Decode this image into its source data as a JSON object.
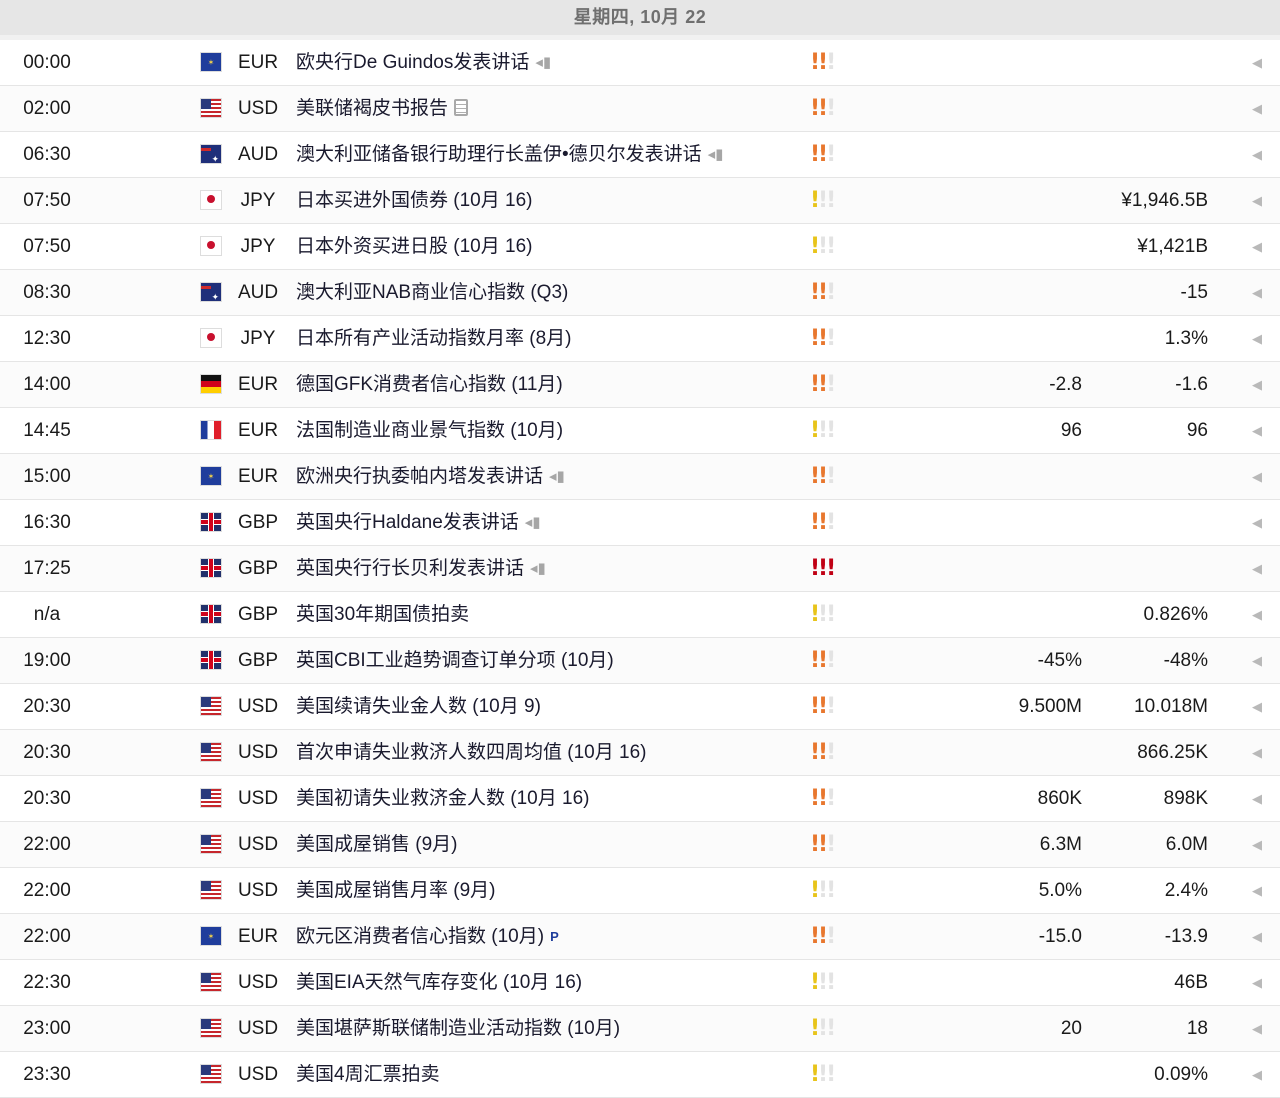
{
  "date_header": "星期四, 10月 22",
  "colors": {
    "impact_high": "#c00014",
    "impact_medium": "#e8772e",
    "impact_low": "#e8c41a",
    "impact_off": "#e3e3e3"
  },
  "events": [
    {
      "time": "00:00",
      "flag": "eu",
      "currency": "EUR",
      "title": "欧央行De Guindos发表讲话",
      "icon": "speaker-icon",
      "impact": 2,
      "forecast": "",
      "previous": ""
    },
    {
      "time": "02:00",
      "flag": "us",
      "currency": "USD",
      "title": "美联储褐皮书报告",
      "icon": "report-icon",
      "impact": 2,
      "forecast": "",
      "previous": ""
    },
    {
      "time": "06:30",
      "flag": "au",
      "currency": "AUD",
      "title": "澳大利亚储备银行助理行长盖伊•德贝尔发表讲话",
      "icon": "speaker-icon",
      "impact": 2,
      "forecast": "",
      "previous": ""
    },
    {
      "time": "07:50",
      "flag": "jp",
      "currency": "JPY",
      "title": "日本买进外国债券 (10月 16)",
      "icon": "",
      "impact": 1,
      "forecast": "",
      "previous": "¥1,946.5B"
    },
    {
      "time": "07:50",
      "flag": "jp",
      "currency": "JPY",
      "title": "日本外资买进日股 (10月 16)",
      "icon": "",
      "impact": 1,
      "forecast": "",
      "previous": "¥1,421B"
    },
    {
      "time": "08:30",
      "flag": "au",
      "currency": "AUD",
      "title": "澳大利亚NAB商业信心指数 (Q3)",
      "icon": "",
      "impact": 2,
      "forecast": "",
      "previous": "-15"
    },
    {
      "time": "12:30",
      "flag": "jp",
      "currency": "JPY",
      "title": "日本所有产业活动指数月率 (8月)",
      "icon": "",
      "impact": 2,
      "forecast": "",
      "previous": "1.3%"
    },
    {
      "time": "14:00",
      "flag": "de",
      "currency": "EUR",
      "title": "德国GFK消费者信心指数 (11月)",
      "icon": "",
      "impact": 2,
      "forecast": "-2.8",
      "previous": "-1.6"
    },
    {
      "time": "14:45",
      "flag": "fr",
      "currency": "EUR",
      "title": "法国制造业商业景气指数 (10月)",
      "icon": "",
      "impact": 1,
      "forecast": "96",
      "previous": "96"
    },
    {
      "time": "15:00",
      "flag": "eu",
      "currency": "EUR",
      "title": "欧洲央行执委帕内塔发表讲话",
      "icon": "speaker-icon",
      "impact": 2,
      "forecast": "",
      "previous": ""
    },
    {
      "time": "16:30",
      "flag": "gb",
      "currency": "GBP",
      "title": "英国央行Haldane发表讲话",
      "icon": "speaker-icon",
      "impact": 2,
      "forecast": "",
      "previous": ""
    },
    {
      "time": "17:25",
      "flag": "gb",
      "currency": "GBP",
      "title": "英国央行行长贝利发表讲话",
      "icon": "speaker-icon",
      "impact": 3,
      "forecast": "",
      "previous": ""
    },
    {
      "time": "n/a",
      "flag": "gb",
      "currency": "GBP",
      "title": "英国30年期国债拍卖",
      "icon": "",
      "impact": 1,
      "forecast": "",
      "previous": "0.826%"
    },
    {
      "time": "19:00",
      "flag": "gb",
      "currency": "GBP",
      "title": "英国CBI工业趋势调查订单分项 (10月)",
      "icon": "",
      "impact": 2,
      "forecast": "-45%",
      "previous": "-48%"
    },
    {
      "time": "20:30",
      "flag": "us",
      "currency": "USD",
      "title": "美国续请失业金人数 (10月 9)",
      "icon": "",
      "impact": 2,
      "forecast": "9.500M",
      "previous": "10.018M"
    },
    {
      "time": "20:30",
      "flag": "us",
      "currency": "USD",
      "title": "首次申请失业救济人数四周均值 (10月 16)",
      "icon": "",
      "impact": 2,
      "forecast": "",
      "previous": "866.25K"
    },
    {
      "time": "20:30",
      "flag": "us",
      "currency": "USD",
      "title": "美国初请失业救济金人数 (10月 16)",
      "icon": "",
      "impact": 2,
      "forecast": "860K",
      "previous": "898K"
    },
    {
      "time": "22:00",
      "flag": "us",
      "currency": "USD",
      "title": "美国成屋销售 (9月)",
      "icon": "",
      "impact": 2,
      "forecast": "6.3M",
      "previous": "6.0M"
    },
    {
      "time": "22:00",
      "flag": "us",
      "currency": "USD",
      "title": "美国成屋销售月率 (9月)",
      "icon": "",
      "impact": 1,
      "forecast": "5.0%",
      "previous": "2.4%"
    },
    {
      "time": "22:00",
      "flag": "eu",
      "currency": "EUR",
      "title": "欧元区消费者信心指数 (10月)",
      "icon": "preliminary-icon",
      "icon_text": "P",
      "impact": 2,
      "forecast": "-15.0",
      "previous": "-13.9"
    },
    {
      "time": "22:30",
      "flag": "us",
      "currency": "USD",
      "title": "美国EIA天然气库存变化 (10月 16)",
      "icon": "",
      "impact": 1,
      "forecast": "",
      "previous": "46B"
    },
    {
      "time": "23:00",
      "flag": "us",
      "currency": "USD",
      "title": "美国堪萨斯联储制造业活动指数 (10月)",
      "icon": "",
      "impact": 1,
      "forecast": "20",
      "previous": "18"
    },
    {
      "time": "23:30",
      "flag": "us",
      "currency": "USD",
      "title": "美国4周汇票拍卖",
      "icon": "",
      "impact": 1,
      "forecast": "",
      "previous": "0.09%"
    }
  ]
}
